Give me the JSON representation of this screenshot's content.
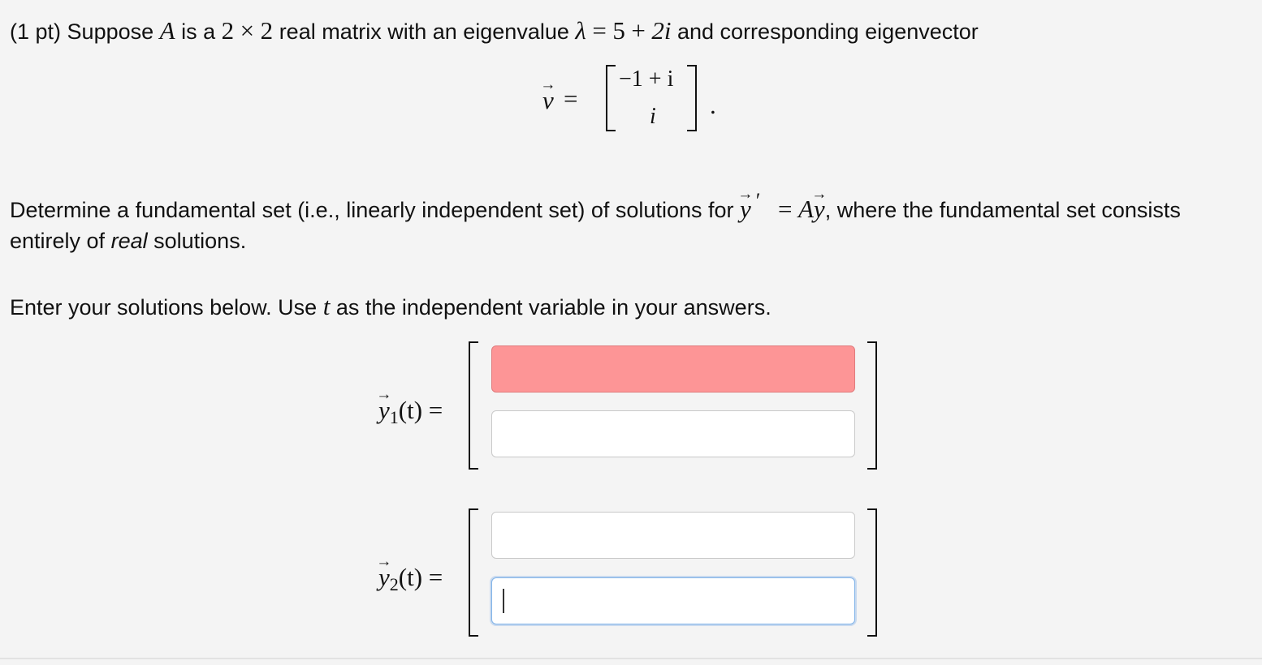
{
  "problem": {
    "points": "(1 pt)",
    "intro_1": "Suppose",
    "A": "A",
    "intro_2": "is a",
    "dim_a": "2",
    "times": "×",
    "dim_b": "2",
    "intro_3": "real matrix with an eigenvalue",
    "lambda": "λ",
    "eq": "=",
    "eig_real": "5",
    "plus": "+",
    "eig_imag": "2i",
    "intro_4": "and corresponding eigenvector",
    "v": "v",
    "v_eq": "=",
    "v_top": "−1 + i",
    "v_bottom": "i",
    "period": "."
  },
  "task": {
    "line1_a": "Determine a fundamental set (i.e., linearly independent set) of solutions for",
    "y": "y",
    "prime": "′",
    "eq": "=",
    "Ay_A": "A",
    "Ay_y": "y",
    "line1_b": ", where the fundamental set consists",
    "line2_a": "entirely of",
    "line2_real": "real",
    "line2_b": "solutions."
  },
  "instruction": {
    "part1": "Enter your solutions below. Use",
    "t": "t",
    "part2": "as the independent variable in your answers."
  },
  "answers": {
    "y1_label_y": "y",
    "y1_label_sub": "1",
    "y1_label_rest": "(t) =",
    "y2_label_y": "y",
    "y2_label_sub": "2",
    "y2_label_rest": "(t) =",
    "y1_top_value": "",
    "y1_bottom_value": "",
    "y2_top_value": "",
    "y2_bottom_value": "",
    "y1_top_state": "error",
    "y2_bottom_state": "focused",
    "error_color": "#fd9596",
    "focus_color": "#7fb2e8"
  }
}
